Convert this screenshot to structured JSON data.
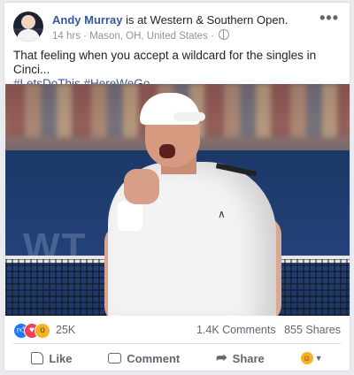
{
  "post": {
    "author": "Andy Murray",
    "checkin_prefix": " is at ",
    "location_name": "Western & Southern Open.",
    "time": "14 hrs",
    "place": "Mason, OH, United States",
    "separator": "·",
    "more_label": "•••",
    "text_line1": "That feeling when you accept a wildcard for the singles in Cinci...",
    "tags": "#LetsDoThis #HereWeGo",
    "photo_wall_text": "WT"
  },
  "stats": {
    "reactions_count": "25K",
    "comments": "1.4K Comments",
    "shares": "855 Shares",
    "reaction_icons": [
      "like",
      "love",
      "wow"
    ]
  },
  "actions": {
    "like_label": "Like",
    "comment_label": "Comment",
    "share_label": "Share"
  },
  "icons": {
    "avatar": "avatar",
    "globe": "globe-icon",
    "like": "thumbs-up-icon",
    "comment": "comment-icon",
    "share": "share-arrow-icon"
  },
  "colors": {
    "link": "#365899",
    "text": "#1d2129",
    "meta": "#90949c",
    "like_blue": "#2078f4",
    "love_red": "#f33e58",
    "wow_yellow": "#f7b125"
  }
}
